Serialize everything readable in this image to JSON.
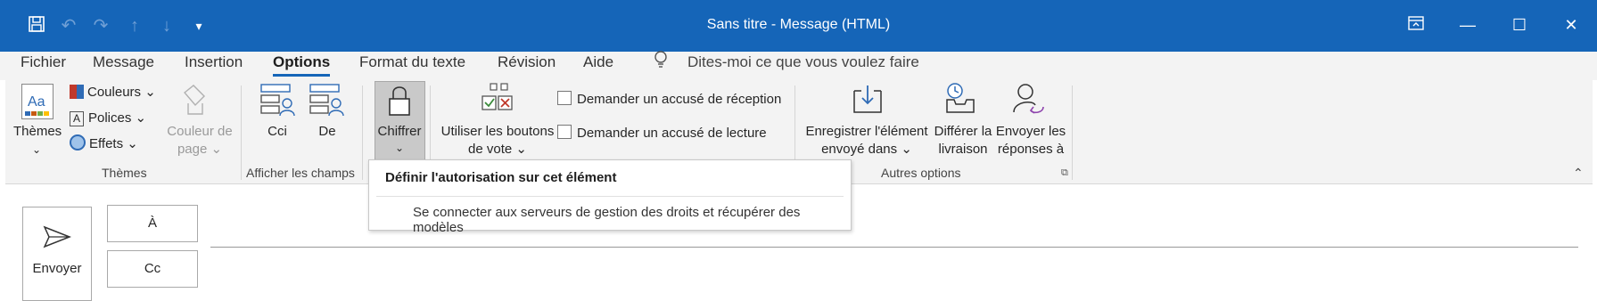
{
  "window": {
    "title": "Sans titre  -  Message (HTML)"
  },
  "quick_access": {
    "save_icon": "save-icon",
    "undo_icon": "undo-icon",
    "redo_icon": "redo-icon",
    "up_icon": "arrow-up-icon",
    "down_icon": "arrow-down-icon",
    "customize_icon": "customize-qat-icon"
  },
  "tabs": [
    {
      "label": "Fichier"
    },
    {
      "label": "Message"
    },
    {
      "label": "Insertion"
    },
    {
      "label": "Options",
      "active": true
    },
    {
      "label": "Format du texte"
    },
    {
      "label": "Révision"
    },
    {
      "label": "Aide"
    }
  ],
  "tell_me": "Dites-moi ce que vous voulez faire",
  "ribbon": {
    "themes_group": {
      "label": "Thèmes",
      "themes_btn": "Thèmes",
      "colors": "Couleurs",
      "fonts": "Polices",
      "effects": "Effets",
      "page_color_line1": "Couleur de",
      "page_color_line2": "page"
    },
    "fields_group": {
      "label": "Afficher les champs",
      "bcc": "Cci",
      "from": "De"
    },
    "encrypt": {
      "label": "Chiffrer"
    },
    "tracking": {
      "vote_line1": "Utiliser les boutons",
      "vote_line2": "de vote",
      "delivery_receipt": "Demander un accusé de réception",
      "read_receipt": "Demander un accusé de lecture"
    },
    "more_group": {
      "label": "Autres options",
      "save_sent_line1": "Enregistrer l'élément",
      "save_sent_line2": "envoyé dans",
      "delay_line1": "Différer la",
      "delay_line2": "livraison",
      "direct_line1": "Envoyer les",
      "direct_line2": "réponses à"
    }
  },
  "dropdown": {
    "header": "Définir l'autorisation sur cet élément",
    "item": "Se connecter aux serveurs de gestion des droits et récupérer des modèles"
  },
  "compose": {
    "send": "Envoyer",
    "to": "À",
    "cc": "Cc"
  },
  "colors": {
    "titlebar": "#1565b8",
    "ribbon": "#f3f3f3"
  }
}
